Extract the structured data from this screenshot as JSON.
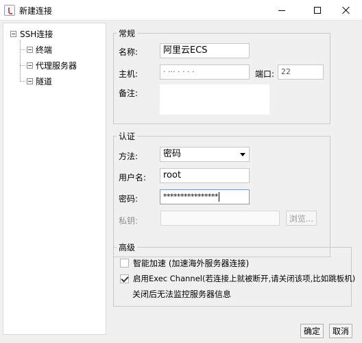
{
  "window": {
    "title": "新建连接"
  },
  "tree": {
    "root": "SSH连接",
    "children": [
      "终端",
      "代理服务器",
      "隧道"
    ]
  },
  "general": {
    "legend": "常规",
    "name_label": "名称:",
    "name_value": "阿里云ECS",
    "host_label": "主机:",
    "host_value": "· ··· · · · ·",
    "port_label": "端口:",
    "port_value": "22",
    "note_label": "备注:",
    "note_value": ""
  },
  "auth": {
    "legend": "认证",
    "method_label": "方法:",
    "method_value": "密码",
    "user_label": "用户名:",
    "user_value": "root",
    "password_label": "密码:",
    "password_value": "****************",
    "key_label": "私钥:",
    "key_value": "",
    "browse_label": "浏览..."
  },
  "advanced": {
    "legend": "高级",
    "accel_label": "智能加速 (加速海外服务器连接)",
    "exec_label": "启用Exec Channel(若连接上就被断开,请关闭该项,比如跳板机)",
    "exec_note": "关闭后无法监控服务器信息"
  },
  "buttons": {
    "ok": "确定",
    "cancel": "取消"
  }
}
